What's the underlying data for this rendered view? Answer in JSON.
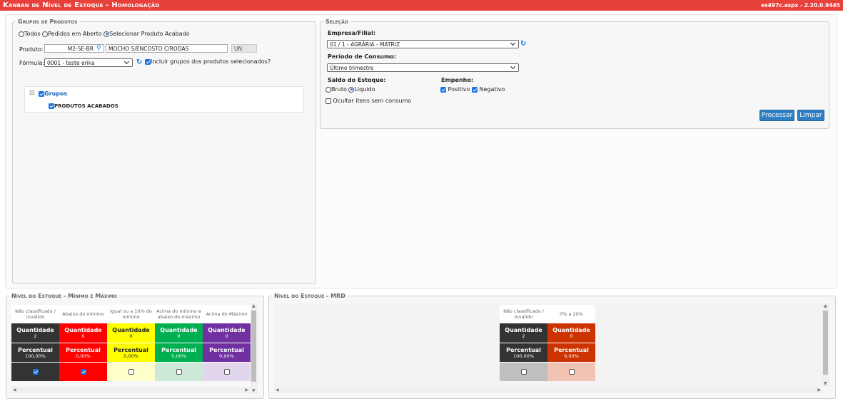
{
  "header": {
    "title": "Kanban de Nível de Estoque  - Homologação",
    "version": "es497c.aspx - 2.20.0.9445"
  },
  "grupos": {
    "legend": "Grupos de Produtos",
    "radio_todos": "Todos",
    "radio_pedidos": "Pedidos em Aberto",
    "radio_selecionar": "Selecionar Produto Acabado",
    "selected_radio": "selecionar",
    "produto_label": "Produto:",
    "produto_code": "M2-SE-BR",
    "produto_desc": "MOCHO S/ENCOSTO C/RODAS",
    "produto_unit": "UN",
    "formula_label": "Fórmula:",
    "formula_value": "0001 - teste erika",
    "incluir_label": "Incluir grupos dos produtos selecionados?",
    "incluir_checked": true,
    "tree_root": "Grupos",
    "tree_child": "PRODUTOS ACABADOS",
    "tree_expander": "⊟"
  },
  "selecao": {
    "legend": "Seleção",
    "empresa_label": "Empresa/Filial:",
    "empresa_value": "01 / 1 - AGRÁRIA - MATRIZ",
    "periodo_label": "Período de Consumo:",
    "periodo_value": "Último trimestre",
    "saldo_label": "Saldo do Estoque:",
    "saldo_bruto": "Bruto",
    "saldo_liquido": "Liquido",
    "saldo_selected": "liquido",
    "empenho_label": "Empenho:",
    "empenho_positivo": "Positivo",
    "empenho_negativo": "Negativo",
    "ocultar_label": "Ocultar itens sem consumo",
    "processar": "Processar",
    "limpar": "Limpar"
  },
  "minmax": {
    "legend": "Nível do Estoque - Mínimo e Máximo",
    "columns": [
      {
        "header": "Não classificado / Inválido",
        "qty_label": "Quantidade",
        "qty": "2",
        "pct_label": "Percentual",
        "pct": "100,00%",
        "color": "#333333",
        "text": "#ffffff",
        "light": "#333333",
        "checked": true
      },
      {
        "header": "Abaixo do mínimo",
        "qty_label": "Quantidade",
        "qty": "0",
        "pct_label": "Percentual",
        "pct": "0,00%",
        "color": "#ff0000",
        "text": "#ffffff",
        "light": "#ff0000",
        "checked": true
      },
      {
        "header": "Igual ou a 10% do mínimo",
        "qty_label": "Quantidade",
        "qty": "0",
        "pct_label": "Percentual",
        "pct": "0,00%",
        "color": "#ffff00",
        "text": "#222222",
        "light": "#ffffcc",
        "checked": false
      },
      {
        "header": "Acima do mínimo e abaixo do máximo",
        "qty_label": "Quantidade",
        "qty": "0",
        "pct_label": "Percentual",
        "pct": "0,00%",
        "color": "#00b050",
        "text": "#ffffff",
        "light": "#cce9d8",
        "checked": false
      },
      {
        "header": "Acima do Máximo",
        "qty_label": "Quantidade",
        "qty": "0",
        "pct_label": "Percentual",
        "pct": "0,00%",
        "color": "#7030a0",
        "text": "#ffffff",
        "light": "#e2d6ec",
        "checked": false
      }
    ]
  },
  "mrd": {
    "legend": "Nível do Estoque - MRD",
    "columns": [
      {
        "header": "Não classificado / Inválido",
        "qty_label": "Quantidade",
        "qty": "2",
        "pct_label": "Percentual",
        "pct": "100,00%",
        "color": "#333333",
        "text": "#ffffff",
        "light": "#bfbfbf",
        "checked": false
      },
      {
        "header": "0% a 20%",
        "qty_label": "Quantidade",
        "qty": "0",
        "pct_label": "Percentual",
        "pct": "0,00%",
        "color": "#cc3300",
        "text": "#ffffff",
        "light": "#f2c3b3",
        "checked": false
      }
    ]
  }
}
